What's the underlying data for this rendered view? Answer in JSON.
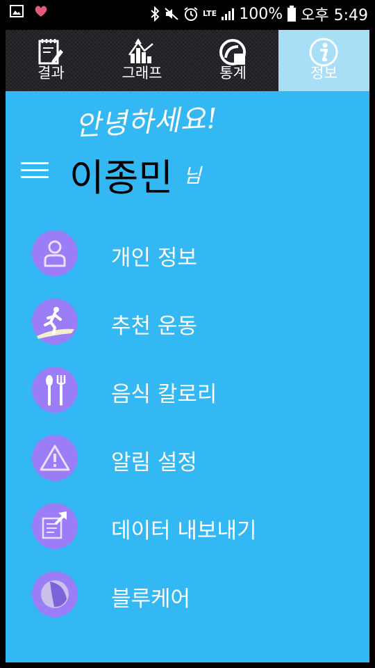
{
  "status_bar": {
    "battery": "100%",
    "time": "오후 5:49",
    "lte": "LTE"
  },
  "tabs": [
    {
      "label": "결과",
      "icon": "notepad-pencil-icon"
    },
    {
      "label": "그래프",
      "icon": "bar-chart-arrow-icon"
    },
    {
      "label": "통계",
      "icon": "pie-gauge-icon"
    },
    {
      "label": "정보",
      "icon": "info-icon",
      "active": true
    }
  ],
  "header": {
    "greeting": "안녕하세요!",
    "user_name": "이종민",
    "honorific": "님"
  },
  "menu": {
    "items": [
      {
        "label": "개인 정보",
        "icon": "person-icon"
      },
      {
        "label": "추천 운동",
        "icon": "runner-icon"
      },
      {
        "label": "음식 칼로리",
        "icon": "spoon-fork-icon"
      },
      {
        "label": "알림 설정",
        "icon": "warning-triangle-icon"
      },
      {
        "label": "데이터 내보내기",
        "icon": "export-document-icon"
      },
      {
        "label": "블루케어",
        "icon": "bluecare-logo-icon"
      }
    ]
  },
  "colors": {
    "background": "#33b8f4",
    "tab_bar": "#1e1b21",
    "active_tab": "#a8def6",
    "icon_circle": "#9b7df7"
  }
}
